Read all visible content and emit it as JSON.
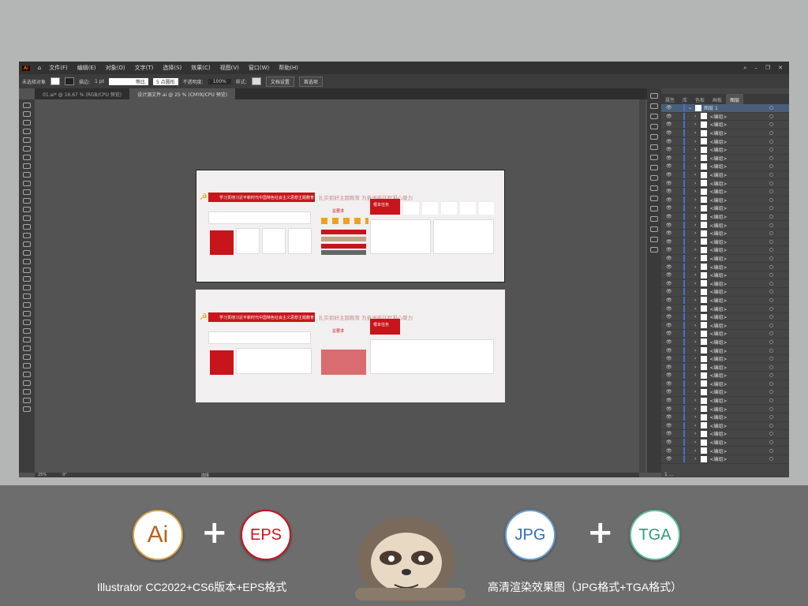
{
  "app": {
    "logo": "Ai",
    "menus": [
      "文件(F)",
      "编辑(E)",
      "对象(O)",
      "文字(T)",
      "选择(S)",
      "效果(C)",
      "视图(V)",
      "窗口(W)",
      "帮助(H)"
    ]
  },
  "control": {
    "selection": "未选择对象",
    "stroke_label": "描边:",
    "stroke_value": "1 pt",
    "stroke_style": "等比",
    "brush": "5 点圆形",
    "opacity_label": "不透明度:",
    "opacity": "100%",
    "style_label": "样式:",
    "doc_setup": "文档设置",
    "prefs": "首选项"
  },
  "tabs": [
    {
      "label": "01.ai* @ 16.67 % (RGB/CPU 预览)",
      "active": false
    },
    {
      "label": "设计源文件.ai @ 25 % (CMYK/CPU 预览)",
      "active": true
    }
  ],
  "panel": {
    "tabs": [
      "属性",
      "库",
      "色板",
      "画板",
      "图层"
    ],
    "active_tab": "图层",
    "top_layer": "图层 1",
    "sublayer_label": "<编组>",
    "sublayer_count": 42,
    "footer": "1 ..."
  },
  "status": {
    "zoom": "25%",
    "rotation": "0°",
    "tool": "选择"
  },
  "artwork": {
    "title": "学习贯彻习近平新时代中国特色社会主义思想主题教育",
    "slogan": "扎实抓好主题教育 为奋进新征程凝心聚力",
    "req": "总要求",
    "task": "根本任务"
  },
  "promo": {
    "ai_label": "Ai",
    "eps_label": "EPS",
    "jpg_label": "JPG",
    "tga_label": "TGA",
    "plus": "+",
    "caption_left": "Illustrator CC2022+CS6版本+EPS格式",
    "caption_right": "高清渲染效果图（JPG格式+TGA格式）",
    "colors": {
      "ai": "#b8621e",
      "eps": "#c8141b",
      "jpg": "#2f6fb5",
      "tga": "#2e9e7a"
    }
  }
}
